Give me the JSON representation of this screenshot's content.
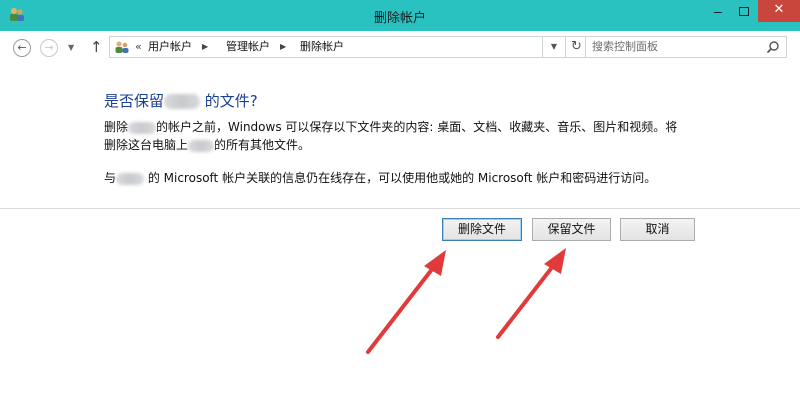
{
  "window": {
    "title": "删除帐户",
    "minimize_label": "",
    "close_label": "✕"
  },
  "nav": {
    "path_prefix": "«",
    "breadcrumbs": [
      "用户帐户",
      "管理帐户",
      "删除帐户"
    ],
    "search_placeholder": "搜索控制面板"
  },
  "content": {
    "heading_before": "是否保留",
    "heading_after": " 的文件?",
    "p1_line1_before": "删除",
    "p1_line1_after": "的帐户之前，Windows 可以保存以下文件夹的内容: 桌面、文档、收藏夹、音乐、图片和视频。将",
    "p1_line2_before": "删除这台电脑上",
    "p1_line2_after": "的所有其他文件。",
    "p2_before": "与",
    "p2_after": " 的 Microsoft 帐户关联的信息仍在线存在，可以使用他或她的 Microsoft 帐户和密码进行访问。"
  },
  "buttons": {
    "delete_files": "删除文件",
    "keep_files": "保留文件",
    "cancel": "取消"
  },
  "colors": {
    "titlebar": "#2ac2c1",
    "heading": "#1c3f94",
    "annotation_arrow": "#e23a3a"
  }
}
